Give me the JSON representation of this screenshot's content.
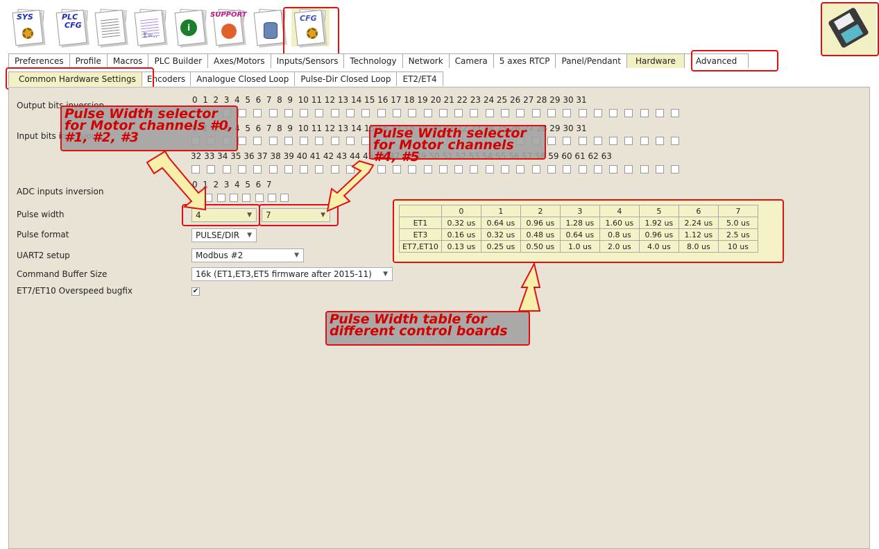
{
  "toolbar": {
    "sys_label": "SYS",
    "plc_label": "PLC",
    "plc_cfg_label": "CFG",
    "support_label": "SUPPORT",
    "cfg_label": "CFG"
  },
  "tabs": [
    "Preferences",
    "Profile",
    "Macros",
    "PLC Builder",
    "Axes/Motors",
    "Inputs/Sensors",
    "Technology",
    "Network",
    "Camera",
    "5 axes RTCP",
    "Panel/Pendant",
    "Hardware",
    "Advanced"
  ],
  "active_tab": "Hardware",
  "subtabs": [
    "Common Hardware Settings",
    "Encoders",
    "Analogue Closed Loop",
    "Pulse-Dir Closed Loop",
    "ET2/ET4"
  ],
  "active_subtab": "Common Hardware Settings",
  "settings": {
    "output_bits_label": "Output bits inversion",
    "input_bits_label": "Input bits inversion",
    "adc_label": "ADC inputs inversion",
    "pulse_width_label": "Pulse width",
    "pulse_format_label": "Pulse format",
    "uart2_label": "UART2 setup",
    "cmd_buffer_label": "Command Buffer Size",
    "overspeed_label": "ET7/ET10 Overspeed bugfix",
    "bits_0_31": "0  1  2  3  4  5  6  7  8  9  10 11 12 13 14 15 16 17 18 19 20 21 22 23 24 25 26 27 28 29 30 31",
    "bits_32_63": "32 33 34 35 36 37 38 39 40 41 42 43 44 45 46 47 48 49 50 51 52 53 54 55 56 57 58 59 60 61 62 63",
    "adc_bits": "0  1  2  3  4  5  6  7",
    "pulse_width_1": "4",
    "pulse_width_2": "7",
    "pulse_format": "PULSE/DIR",
    "uart2": "Modbus #2",
    "cmd_buffer": "16k (ET1,ET3,ET5 firmware after 2015-11)",
    "overspeed_checked": true
  },
  "pw_table": {
    "header": [
      "",
      "0",
      "1",
      "2",
      "3",
      "4",
      "5",
      "6",
      "7"
    ],
    "rows": [
      [
        "ET1",
        "0.32 us",
        "0.64 us",
        "0.96 us",
        "1.28 us",
        "1.60 us",
        "1.92 us",
        "2.24 us",
        "5.0  us"
      ],
      [
        "ET3",
        "0.16 us",
        "0.32 us",
        "0.48 us",
        "0.64 us",
        "0.8  us",
        "0.96 us",
        "1.12 us",
        "2.5  us"
      ],
      [
        "ET7,ET10",
        "0.13 us",
        "0.25 us",
        "0.50 us",
        "1.0  us",
        "2.0  us",
        "4.0  us",
        "8.0 us",
        "10 us"
      ]
    ]
  },
  "annotations": {
    "callout_1": "Pulse Width selector for Motor channels #0, #1, #2, #3",
    "callout_2": "Pulse Width selector for Motor channels #4, #5",
    "callout_3": "Pulse Width table for different control boards"
  },
  "colors": {
    "highlight": "#f3f0c4",
    "annotation_red": "#e01010",
    "panel_bg": "#e9e3d5"
  }
}
